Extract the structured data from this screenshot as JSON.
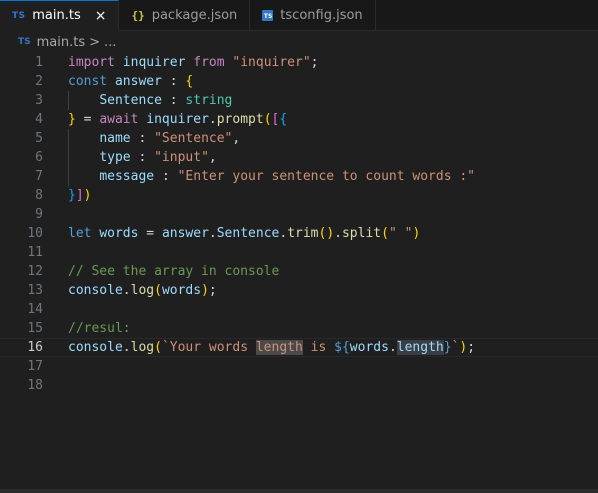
{
  "tabs": [
    {
      "icon": "TS",
      "label": "main.ts",
      "active": true,
      "close": "×"
    },
    {
      "icon": "{}",
      "label": "package.json",
      "active": false
    },
    {
      "icon": "TS",
      "label": "tsconfig.json",
      "active": false
    }
  ],
  "breadcrumb": {
    "icon": "TS",
    "file": "main.ts",
    "separator": ">",
    "tail": "..."
  },
  "editor": {
    "current_line": 16,
    "line_numbers": [
      "1",
      "2",
      "3",
      "4",
      "5",
      "6",
      "7",
      "8",
      "9",
      "10",
      "11",
      "12",
      "13",
      "14",
      "15",
      "16",
      "17",
      "18"
    ],
    "lines": [
      "import inquirer from \"inquirer\";",
      "const answer : {",
      "    Sentence : string",
      "} = await inquirer.prompt([{",
      "    name : \"Sentence\",",
      "    type : \"input\",",
      "    message : \"Enter your sentence to count words :\"",
      "}])",
      "",
      "let words = answer.Sentence.trim().split(\" \")",
      "",
      "// See the array in console",
      "console.log(words);",
      "",
      "//resul:",
      "console.log(`Your words length is ${words.length}`);",
      "",
      ""
    ]
  },
  "colors": {
    "background": "#1f1f1f",
    "keyword": "#c586c0",
    "declaration": "#569cd6",
    "variable": "#9cdcfe",
    "function": "#dcdcaa",
    "string": "#ce9178",
    "type": "#4ec9b0",
    "comment": "#6a9955",
    "ts_icon": "#3178c6",
    "json_icon": "#cbcb41"
  }
}
